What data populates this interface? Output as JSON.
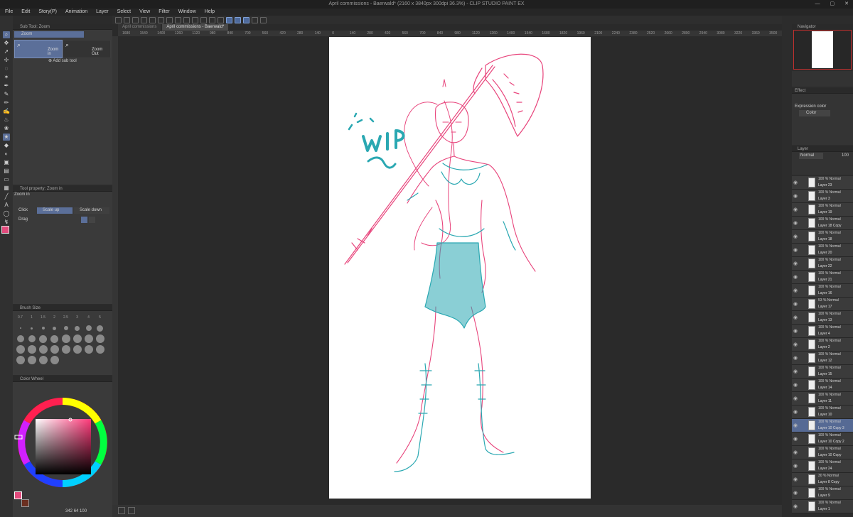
{
  "window": {
    "title": "April commissions - Baerwald* (2160 x 3840px 300dpi 36.3%) - CLIP STUDIO PAINT EX"
  },
  "menu": [
    "File",
    "Edit",
    "Story(P)",
    "Animation",
    "Layer",
    "Select",
    "View",
    "Filter",
    "Window",
    "Help"
  ],
  "sub_tool": {
    "panel_title": "Sub Tool: Zoom",
    "group": "Zoom",
    "items": [
      "Zoom in",
      "Zoom Out"
    ],
    "add_label": "Add sub tool"
  },
  "tool_property": {
    "panel_title": "Tool property: Zoom in",
    "tool_name": "Zoom in",
    "click_label": "Click",
    "scale_up": "Scale up",
    "scale_down": "Scale down",
    "drag_label": "Drag"
  },
  "brush_size": {
    "panel_title": "Brush Size",
    "labels": [
      "0.7",
      "1",
      "1.5",
      "2",
      "2.5",
      "3",
      "4",
      "5"
    ]
  },
  "color_wheel": {
    "panel_title": "Color Wheel",
    "main_color": "#e24b7d",
    "sub_color": "#6b2f20",
    "readout": "342",
    "readout2": "64",
    "readout3": "100"
  },
  "tabs": [
    "April commissions",
    "April commissions - Baerwald*"
  ],
  "ruler_ticks": [
    "1680",
    "1540",
    "1400",
    "1260",
    "1120",
    "980",
    "840",
    "700",
    "560",
    "420",
    "280",
    "140",
    "0",
    "140",
    "280",
    "420",
    "560",
    "700",
    "840",
    "980",
    "1120",
    "1260",
    "1400",
    "1540",
    "1680",
    "1820",
    "1960",
    "2100",
    "2240",
    "2380",
    "2520",
    "2660",
    "2800",
    "2940",
    "3080",
    "3220",
    "3360",
    "3500"
  ],
  "canvas": {
    "wip_text": "WIP",
    "pink": "#e8457c",
    "teal": "#2aa8b2"
  },
  "right": {
    "navigator_title": "Navigator",
    "effect_label": "Effect",
    "expression_label": "Expression color",
    "expression_value": "Color",
    "layer_title": "Layer",
    "blend_mode": "Normal",
    "opacity": "100"
  },
  "layers": [
    {
      "mode": "100 % Normal",
      "name": "Layer 23"
    },
    {
      "mode": "100 % Normal",
      "name": "Layer 3"
    },
    {
      "mode": "100 % Normal",
      "name": "Layer 19"
    },
    {
      "mode": "100 % Normal",
      "name": "Layer 18 Copy"
    },
    {
      "mode": "100 % Normal",
      "name": "Layer 18"
    },
    {
      "mode": "100 % Normal",
      "name": "Layer 20"
    },
    {
      "mode": "100 % Normal",
      "name": "Layer 22"
    },
    {
      "mode": "100 % Normal",
      "name": "Layer 21"
    },
    {
      "mode": "100 % Normal",
      "name": "Layer 16"
    },
    {
      "mode": "53 % Normal",
      "name": "Layer 17"
    },
    {
      "mode": "100 % Normal",
      "name": "Layer 13"
    },
    {
      "mode": "100 % Normal",
      "name": "Layer 4"
    },
    {
      "mode": "100 % Normal",
      "name": "Layer 2"
    },
    {
      "mode": "100 % Normal",
      "name": "Layer 12"
    },
    {
      "mode": "100 % Normal",
      "name": "Layer 15"
    },
    {
      "mode": "100 % Normal",
      "name": "Layer 14"
    },
    {
      "mode": "100 % Normal",
      "name": "Layer 11"
    },
    {
      "mode": "100 % Normal",
      "name": "Layer 10"
    },
    {
      "mode": "100 % Normal",
      "name": "Layer 10 Copy 3",
      "selected": true
    },
    {
      "mode": "100 % Normal",
      "name": "Layer 10 Copy 2"
    },
    {
      "mode": "100 % Normal",
      "name": "Layer 10 Copy"
    },
    {
      "mode": "100 % Normal",
      "name": "Layer 24"
    },
    {
      "mode": "30 % Normal",
      "name": "Layer 8 Copy"
    },
    {
      "mode": "100 % Normal",
      "name": "Layer 9"
    },
    {
      "mode": "100 % Normal",
      "name": "Layer 1"
    }
  ]
}
